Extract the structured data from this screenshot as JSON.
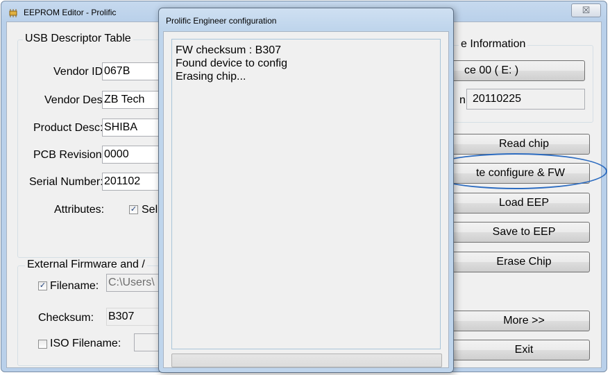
{
  "main_window": {
    "title": "EEPROM Editor - Prolific",
    "close_glyph": "☒"
  },
  "usb_descriptor": {
    "group_title": "USB Descriptor Table",
    "vendor_id_label": "Vendor ID:",
    "vendor_id_value": "067B",
    "vendor_desc_label": "Vendor Desc:",
    "vendor_desc_value": "ZB Tech",
    "product_desc_label": "Product Desc:",
    "product_desc_value": "SHIBA",
    "pcb_revision_label": "PCB Revision:",
    "pcb_revision_value": "0000",
    "serial_number_label": "Serial Number:",
    "serial_number_value": "201102",
    "attributes_label": "Attributes:",
    "attributes_option": "Sel"
  },
  "external_firmware": {
    "group_title": "External Firmware and /",
    "filename_label": "Filename:",
    "filename_value": "C:\\Users\\",
    "checksum_label": "Checksum:",
    "checksum_value": "B307",
    "iso_filename_label": "ISO Filename:",
    "iso_filename_value": ""
  },
  "device_info": {
    "group_title": "e Information",
    "device_select_value": "ce 00 ( E: )",
    "version_label": "n:",
    "version_value": "20110225"
  },
  "buttons": {
    "read_chip": "Read chip",
    "write_configure_fw": "te configure & FW",
    "load_eep": "Load EEP",
    "save_to_eep": "Save to EEP",
    "erase_chip": "Erase Chip",
    "more": "More >>",
    "exit": "Exit"
  },
  "dialog": {
    "title": "Prolific Engineer configuration",
    "log_lines": [
      "FW checksum : B307",
      "Found device to config",
      "Erasing chip..."
    ],
    "progress": 0
  },
  "colors": {
    "highlight_ellipse": "#2d6cc0"
  }
}
